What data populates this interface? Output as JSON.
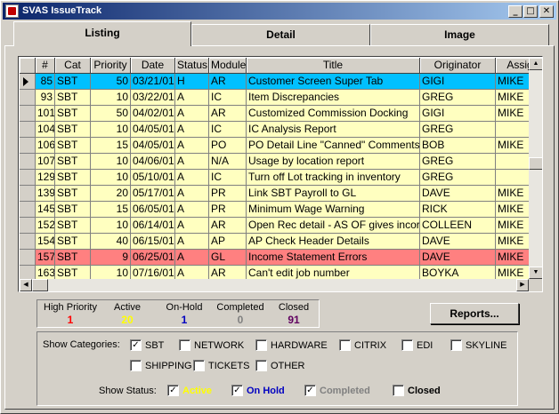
{
  "window": {
    "title": "SVAS IssueTrack"
  },
  "title_buttons": {
    "minimize": "_",
    "maximize": "□",
    "close": "✕"
  },
  "tabs": [
    {
      "label": "Listing",
      "active": true
    },
    {
      "label": "Detail",
      "active": false
    },
    {
      "label": "Image",
      "active": false
    }
  ],
  "table": {
    "columns": [
      "#",
      "Cat",
      "Priority",
      "Date",
      "Status",
      "Module",
      "Title",
      "Originator",
      "Assig"
    ],
    "rows": [
      {
        "num": "85",
        "cat": "SBT",
        "priority": "50",
        "date": "03/21/01",
        "status": "H",
        "module": "AR",
        "title": "Customer Screen Super Tab",
        "originator": "GIGI",
        "assigned": "MIKE",
        "bg": "#00c0ff",
        "current": true
      },
      {
        "num": "93",
        "cat": "SBT",
        "priority": "10",
        "date": "03/22/01",
        "status": "A",
        "module": "IC",
        "title": "Item Discrepancies",
        "originator": "GREG",
        "assigned": "MIKE",
        "bg": "#ffffc0"
      },
      {
        "num": "101",
        "cat": "SBT",
        "priority": "50",
        "date": "04/02/01",
        "status": "A",
        "module": "AR",
        "title": "Customized Commission Docking",
        "originator": "GIGI",
        "assigned": "MIKE",
        "bg": "#ffffc0"
      },
      {
        "num": "104",
        "cat": "SBT",
        "priority": "10",
        "date": "04/05/01",
        "status": "A",
        "module": "IC",
        "title": "IC Analysis Report",
        "originator": "GREG",
        "assigned": "",
        "bg": "#ffffc0"
      },
      {
        "num": "106",
        "cat": "SBT",
        "priority": "15",
        "date": "04/05/01",
        "status": "A",
        "module": "PO",
        "title": "PO Detail Line \"Canned\" Comments",
        "originator": "BOB",
        "assigned": "MIKE",
        "bg": "#ffffc0"
      },
      {
        "num": "107",
        "cat": "SBT",
        "priority": "10",
        "date": "04/06/01",
        "status": "A",
        "module": "N/A",
        "title": "Usage by location report",
        "originator": "GREG",
        "assigned": "",
        "bg": "#ffffc0"
      },
      {
        "num": "129",
        "cat": "SBT",
        "priority": "10",
        "date": "05/10/01",
        "status": "A",
        "module": "IC",
        "title": "Turn off Lot tracking in inventory",
        "originator": "GREG",
        "assigned": "",
        "bg": "#ffffc0"
      },
      {
        "num": "139",
        "cat": "SBT",
        "priority": "20",
        "date": "05/17/01",
        "status": "A",
        "module": "PR",
        "title": "Link SBT Payroll to GL",
        "originator": "DAVE",
        "assigned": "MIKE",
        "bg": "#ffffc0"
      },
      {
        "num": "145",
        "cat": "SBT",
        "priority": "15",
        "date": "06/05/01",
        "status": "A",
        "module": "PR",
        "title": "Minimum Wage Warning",
        "originator": "RICK",
        "assigned": "MIKE",
        "bg": "#ffffc0"
      },
      {
        "num": "152",
        "cat": "SBT",
        "priority": "10",
        "date": "06/14/01",
        "status": "A",
        "module": "AR",
        "title": "Open Rec detail - AS OF gives incorrect",
        "originator": "COLLEEN",
        "assigned": "MIKE",
        "bg": "#ffffc0"
      },
      {
        "num": "154",
        "cat": "SBT",
        "priority": "40",
        "date": "06/15/01",
        "status": "A",
        "module": "AP",
        "title": "AP Check Header Details",
        "originator": "DAVE",
        "assigned": "MIKE",
        "bg": "#ffffc0"
      },
      {
        "num": "157",
        "cat": "SBT",
        "priority": "9",
        "date": "06/25/01",
        "status": "A",
        "module": "GL",
        "title": "Income Statement Errors",
        "originator": "DAVE",
        "assigned": "MIKE",
        "bg": "#ff8080"
      },
      {
        "num": "163",
        "cat": "SBT",
        "priority": "10",
        "date": "07/16/01",
        "status": "A",
        "module": "AR",
        "title": "Can't edit job number",
        "originator": "BOYKA",
        "assigned": "MIKE",
        "bg": "#ffffc0"
      }
    ]
  },
  "stats": [
    {
      "label": "High Priority",
      "value": "1",
      "color": "#ff0000"
    },
    {
      "label": "Active",
      "value": "20",
      "color": "#ffff00"
    },
    {
      "label": "On-Hold",
      "value": "1",
      "color": "#0000c0"
    },
    {
      "label": "Completed",
      "value": "0",
      "color": "#808080"
    },
    {
      "label": "Closed",
      "value": "91",
      "color": "#600060"
    }
  ],
  "reports_button": "Reports...",
  "filters": {
    "categories_label": "Show Categories:",
    "categories": [
      {
        "label": "SBT",
        "checked": true
      },
      {
        "label": "NETWORK",
        "checked": false
      },
      {
        "label": "HARDWARE",
        "checked": false
      },
      {
        "label": "CITRIX",
        "checked": false
      },
      {
        "label": "EDI",
        "checked": false
      },
      {
        "label": "SKYLINE",
        "checked": false
      },
      {
        "label": "SHIPPING",
        "checked": false
      },
      {
        "label": "TICKETS",
        "checked": false
      },
      {
        "label": "OTHER",
        "checked": false
      }
    ],
    "status_label": "Show Status:",
    "statuses": [
      {
        "label": "Active",
        "checked": true,
        "color": "#ffff00"
      },
      {
        "label": "On Hold",
        "checked": true,
        "color": "#0000c0"
      },
      {
        "label": "Completed",
        "checked": true,
        "color": "#808080"
      },
      {
        "label": "Closed",
        "checked": false,
        "color": "#000000"
      }
    ]
  }
}
